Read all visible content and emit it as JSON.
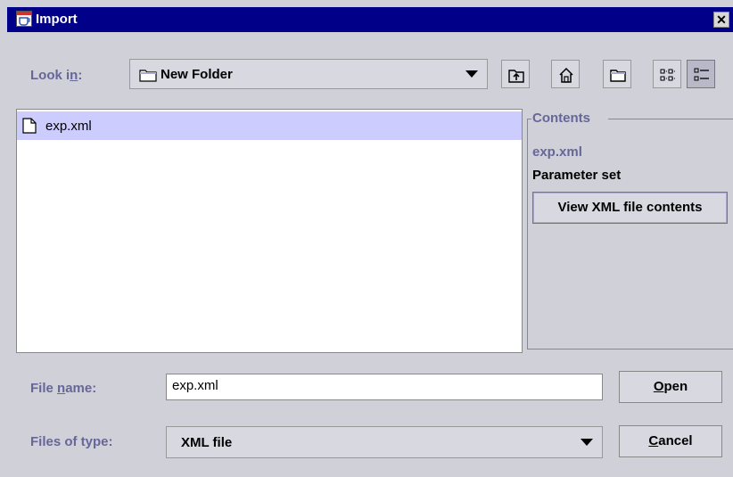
{
  "window": {
    "title": "Import",
    "title_icon": "java-cup-icon",
    "close_glyph": "✕"
  },
  "look_in": {
    "label_before": "Look i",
    "label_mnemonic": "n",
    "label_after": ":",
    "value": "New Folder"
  },
  "toolbar": {
    "buttons": [
      "up-one-level-icon",
      "home-icon",
      "new-folder-icon",
      "list-view-icon",
      "details-view-icon"
    ]
  },
  "file_list": {
    "items": [
      {
        "name": "exp.xml",
        "selected": true,
        "icon": "file-icon"
      }
    ]
  },
  "contents": {
    "title": "Contents",
    "file_name": "exp.xml",
    "type": "Parameter set",
    "view_button": "View XML file contents"
  },
  "file_name": {
    "label_before": "File ",
    "label_mnemonic": "n",
    "label_after": "ame:",
    "value": "exp.xml"
  },
  "file_type": {
    "label": "Files of type:",
    "value": "XML file"
  },
  "buttons": {
    "open_mnemonic": "O",
    "open_rest": "pen",
    "cancel_mnemonic": "C",
    "cancel_rest": "ancel"
  },
  "colors": {
    "title_bar": "#000088",
    "label": "#666699",
    "selection": "#ccccff",
    "background": "#d0d0d8"
  }
}
